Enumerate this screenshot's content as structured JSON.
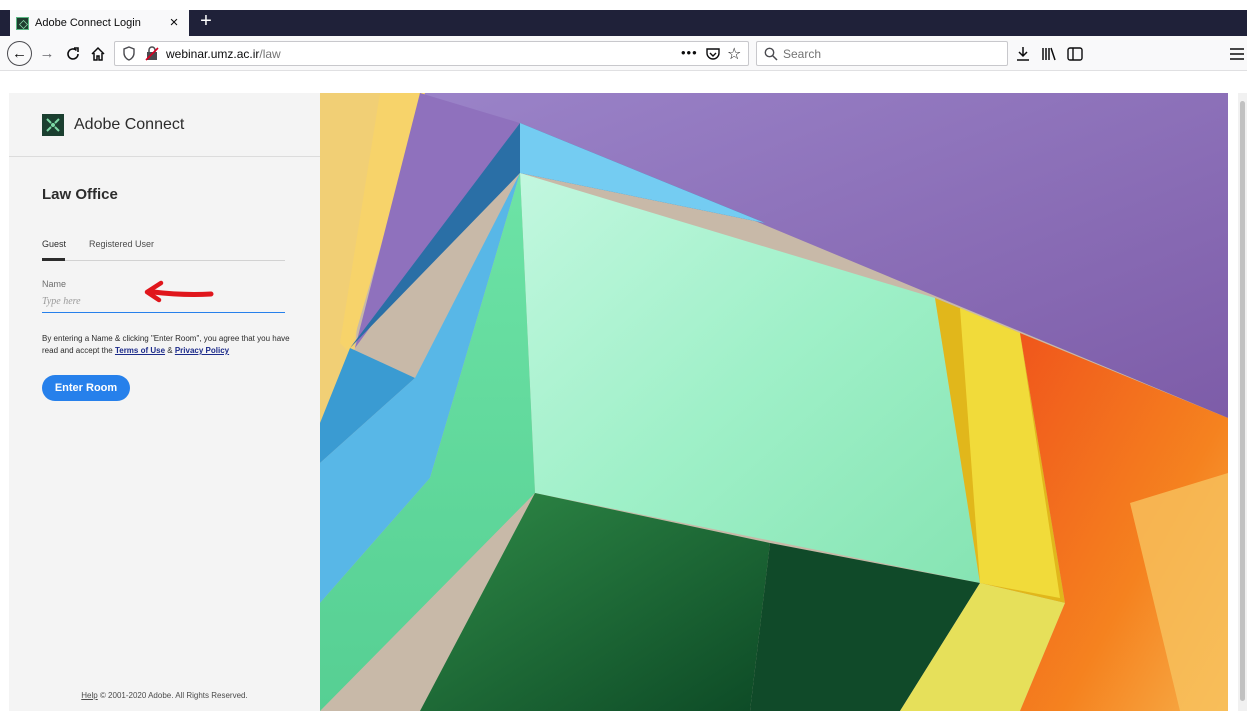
{
  "browser": {
    "tab": {
      "title": "Adobe Connect Login",
      "close_glyph": "×",
      "favicon": "adobe-connect-favicon"
    },
    "new_tab_glyph": "+",
    "nav": {
      "back": "←",
      "forward": "→",
      "reload": "C",
      "home": "⌂"
    },
    "url": {
      "host": "webinar.umz.ac.ir",
      "path": "/law"
    },
    "url_more": "•••",
    "search": {
      "placeholder": "Search"
    },
    "icons": [
      "shield-icon",
      "insecure-lock-icon",
      "pocket-icon",
      "star-icon",
      "search-icon",
      "download-icon",
      "library-icon",
      "sidebar-icon",
      "menu-icon"
    ]
  },
  "page": {
    "brand": {
      "name": "Adobe Connect"
    },
    "room_title": "Law Office",
    "tabs": {
      "guest": "Guest",
      "registered": "Registered User"
    },
    "form": {
      "name_label": "Name",
      "name_placeholder": "Type here",
      "agree_prefix": "By entering a Name & clicking \"Enter Room\", you agree that you have read and accept the ",
      "terms_link": "Terms of Use",
      "and": " & ",
      "privacy_link": "Privacy Policy",
      "enter_button": "Enter Room"
    },
    "footer": {
      "help_link": "Help",
      "copyright": " © 2001-2020 Adobe. All Rights Reserved."
    },
    "colors": {
      "accent": "#2680eb",
      "link": "#1b2a8a",
      "annotation_arrow": "#e0161c"
    }
  }
}
